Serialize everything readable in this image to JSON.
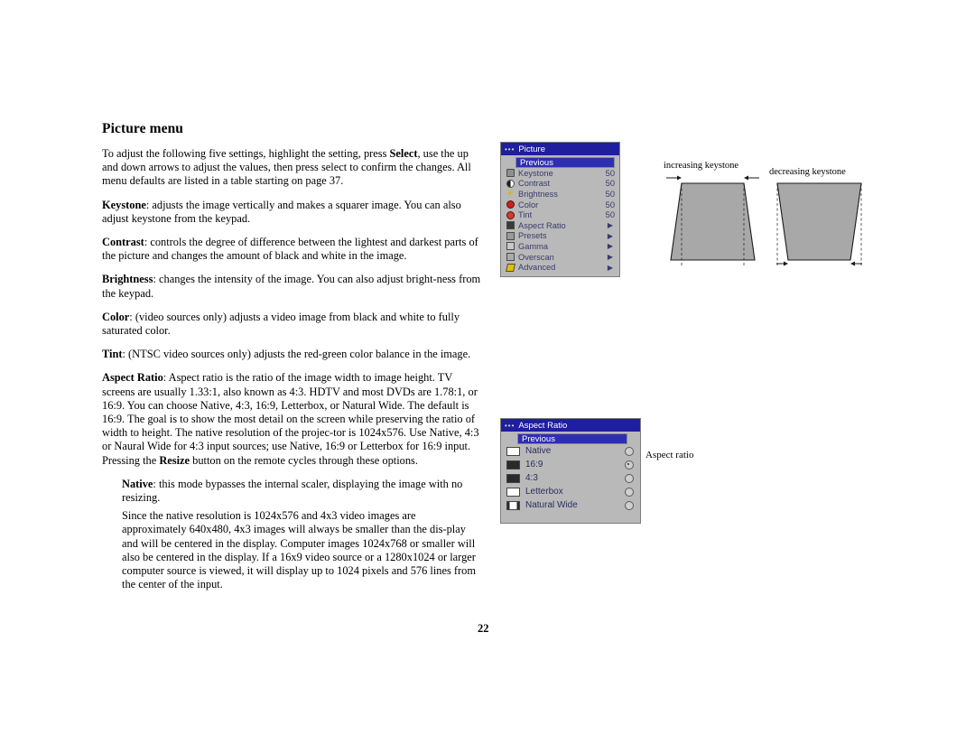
{
  "document": {
    "title": "Picture menu",
    "page_number": "22",
    "paragraphs": [
      {
        "id": "intro",
        "runs": [
          {
            "text": "To adjust the following five settings, highlight the setting, press ",
            "bold": false
          },
          {
            "text": "Select",
            "bold": true
          },
          {
            "text": ", use the up and down arrows to adjust the values, then press select to confirm the changes. All menu defaults are listed in a table starting on page 37.",
            "bold": false
          }
        ]
      },
      {
        "id": "keystone",
        "runs": [
          {
            "text": "Keystone",
            "bold": true
          },
          {
            "text": ": adjusts the image vertically and makes a squarer image. You can also adjust keystone from the keypad.",
            "bold": false
          }
        ]
      },
      {
        "id": "contrast",
        "runs": [
          {
            "text": "Contrast",
            "bold": true
          },
          {
            "text": ": controls the degree of difference between the lightest and darkest parts of the picture and changes the amount of black and white in the image.",
            "bold": false
          }
        ]
      },
      {
        "id": "brightness",
        "runs": [
          {
            "text": "Brightness",
            "bold": true
          },
          {
            "text": ": changes the intensity of the image. You can also adjust bright-ness from the keypad.",
            "bold": false
          }
        ]
      },
      {
        "id": "color",
        "runs": [
          {
            "text": "Color",
            "bold": true
          },
          {
            "text": ": (video sources only) adjusts a video image from black and white to fully saturated color.",
            "bold": false
          }
        ]
      },
      {
        "id": "tint",
        "runs": [
          {
            "text": "Tint",
            "bold": true
          },
          {
            "text": ": (NTSC video sources only) adjusts the red-green color balance in the image.",
            "bold": false
          }
        ]
      },
      {
        "id": "aspect-ratio",
        "runs": [
          {
            "text": "Aspect Ratio",
            "bold": true
          },
          {
            "text": ": Aspect ratio is the ratio of the image width to image height. TV screens are usually 1.33:1, also known as 4:3. HDTV and most DVDs are 1.78:1, or 16:9. You can choose Native, 4:3, 16:9, Letterbox, or Natural Wide. The default is 16:9. The goal is to show the most detail on the screen while preserving the ratio of width to height. The native resolution of the projec-tor is 1024x576. Use Native, 4:3 or Naural Wide for 4:3 input sources; use Native, 16:9 or Letterbox for 16:9 input. Pressing the ",
            "bold": false
          },
          {
            "text": "Resize",
            "bold": true
          },
          {
            "text": " button on the remote cycles through these options.",
            "bold": false
          }
        ]
      },
      {
        "id": "native",
        "indent": true,
        "runs": [
          {
            "text": "Native",
            "bold": true
          },
          {
            "text": ": this mode bypasses the internal scaler, displaying the image with no resizing.",
            "bold": false
          }
        ]
      },
      {
        "id": "native2",
        "indent": true,
        "runs": [
          {
            "text": "Since the native resolution is 1024x576 and 4x3 video images are approximately 640x480, 4x3 images will always be smaller than the dis-play and will be centered in the display.  Computer images 1024x768 or smaller will also be centered in the display.  If a 16x9 video source or a 1280x1024 or larger computer source is viewed, it will display up to 1024 pixels and 576 lines from the center of the input.",
            "bold": false
          }
        ]
      }
    ]
  },
  "picture_menu": {
    "title": "Picture",
    "previous_label": "Previous",
    "items": [
      {
        "icon": "keystone-icon",
        "label": "Keystone",
        "value": "50",
        "arrow": ""
      },
      {
        "icon": "contrast-icon",
        "label": "Contrast",
        "value": "50",
        "arrow": ""
      },
      {
        "icon": "brightness-icon",
        "label": "Brightness",
        "value": "50",
        "arrow": ""
      },
      {
        "icon": "color-icon",
        "label": "Color",
        "value": "50",
        "arrow": ""
      },
      {
        "icon": "tint-icon",
        "label": "Tint",
        "value": "50",
        "arrow": ""
      },
      {
        "icon": "aspect-ratio-icon",
        "label": "Aspect Ratio",
        "value": "",
        "arrow": "▶"
      },
      {
        "icon": "presets-icon",
        "label": "Presets",
        "value": "",
        "arrow": "▶"
      },
      {
        "icon": "gamma-icon",
        "label": "Gamma",
        "value": "",
        "arrow": "▶"
      },
      {
        "icon": "overscan-icon",
        "label": "Overscan",
        "value": "",
        "arrow": "▶"
      },
      {
        "icon": "advanced-icon",
        "label": "Advanced",
        "value": "",
        "arrow": "▶"
      }
    ]
  },
  "aspect_menu": {
    "title": "Aspect Ratio",
    "previous_label": "Previous",
    "options": [
      {
        "label": "Native",
        "selected": false,
        "swatch": "native-swatch"
      },
      {
        "label": "16:9",
        "selected": true,
        "swatch": "sixteen-nine-swatch"
      },
      {
        "label": "4:3",
        "selected": false,
        "swatch": "four-three-swatch"
      },
      {
        "label": "Letterbox",
        "selected": false,
        "swatch": "letterbox-swatch"
      },
      {
        "label": "Natural Wide",
        "selected": false,
        "swatch": "natural-wide-swatch"
      }
    ],
    "callout": "Aspect ratio"
  },
  "keystone_figure": {
    "increasing_label": "increasing keystone",
    "decreasing_label": "decreasing keystone"
  },
  "colors": {
    "menu_title_bar": "#1e1e9e",
    "menu_highlight": "#2e2eb4",
    "menu_background": "#b9b9b9",
    "shape_fill": "#a8a8a8"
  }
}
